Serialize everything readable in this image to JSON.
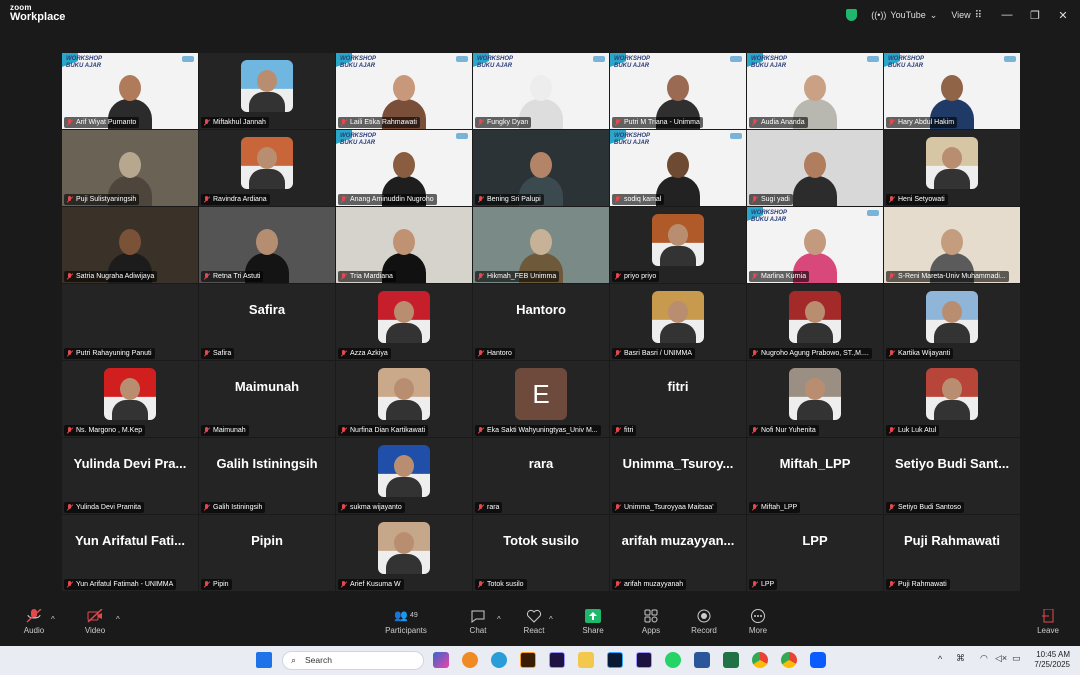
{
  "app": {
    "logo_line1": "zoom",
    "logo_line2": "Workplace"
  },
  "titlebar": {
    "stream_label": "YouTube",
    "view_label": "View"
  },
  "tiles": [
    {
      "name": "Arif Wiyat Purnanto",
      "type": "video",
      "bg": "banner",
      "skin": "#b07b5a",
      "cloth": "#2b2b2b",
      "active": true
    },
    {
      "name": "Miftakhul Jannah",
      "type": "avatar",
      "avatar_color": "#6fb6e0"
    },
    {
      "name": "Laili Etika Rahmawati",
      "type": "video",
      "bg": "banner",
      "skin": "#c7987a",
      "cloth": "#7a4f3a"
    },
    {
      "name": "Fungky Dyan",
      "type": "video",
      "bg": "banner",
      "skin": "#ededed",
      "cloth": "#dddddd"
    },
    {
      "name": "Putri M Triana - Unimma",
      "type": "video",
      "bg": "banner",
      "skin": "#9a6b52",
      "cloth": "#2f2f2f"
    },
    {
      "name": "Audia Ananda",
      "type": "video",
      "bg": "banner",
      "skin": "#caa184",
      "cloth": "#b8b8b0"
    },
    {
      "name": "Hary Abdul Hakim",
      "type": "video",
      "bg": "banner",
      "skin": "#8f6447",
      "cloth": "#1f3a66"
    },
    {
      "name": "Puji Sulistyaningsih",
      "type": "video",
      "bg": "#6b6256",
      "skin": "#b8a78f",
      "cloth": "#4e463c"
    },
    {
      "name": "Ravindra Ardiana",
      "type": "avatar",
      "avatar_color": "#c8663a"
    },
    {
      "name": "Anang Aminuddin Nugroho",
      "type": "video",
      "bg": "banner",
      "skin": "#8a5d40",
      "cloth": "#1e1e1e"
    },
    {
      "name": "Bening Sri Palupi",
      "type": "video",
      "bg": "#2b3336",
      "skin": "#b48468",
      "cloth": "#3a4a4e"
    },
    {
      "name": "sodiq kamal",
      "type": "video",
      "bg": "slide",
      "skin": "#6f4a33",
      "cloth": "#222"
    },
    {
      "name": "Sugi yadi",
      "type": "video",
      "bg": "#d8d8d8",
      "skin": "#b07d5e",
      "cloth": "#2c2c2c"
    },
    {
      "name": "Heni Setyowati",
      "type": "avatar",
      "avatar_color": "#d7c6a4"
    },
    {
      "name": "Satria Nugraha Adiwijaya",
      "type": "video",
      "bg": "#3a3228",
      "skin": "#7a5238",
      "cloth": "#1c1c1c"
    },
    {
      "name": "Retna Tri Astuti",
      "type": "video",
      "bg": "#545454",
      "skin": "#b58e72",
      "cloth": "#141414"
    },
    {
      "name": "Tria Mardiana",
      "type": "video",
      "bg": "#d6d2cc",
      "skin": "#c09274",
      "cloth": "#111"
    },
    {
      "name": "Hikmah_FEB Unimma",
      "type": "video",
      "bg": "#7a8a86",
      "skin": "#c7b197",
      "cloth": "#6e5a3a"
    },
    {
      "name": "priyo priyo",
      "type": "avatar",
      "avatar_color": "#b05a2a"
    },
    {
      "name": "Marlina Kurnia",
      "type": "video",
      "bg": "banner",
      "skin": "#c49a7e",
      "cloth": "#d9487b"
    },
    {
      "name": "S-Reni Mareta-Univ Muhammadi...",
      "type": "video",
      "bg": "#e5dccd",
      "skin": "#c49d7f",
      "cloth": "#5b5b5b"
    },
    {
      "name": "Putri Rahayuning Panuti",
      "type": "blank"
    },
    {
      "name": "Safira",
      "type": "text",
      "big": "Safira"
    },
    {
      "name": "Azza Azkiya",
      "type": "avatar",
      "avatar_color": "#c61f2b"
    },
    {
      "name": "Hantoro",
      "type": "text",
      "big": "Hantoro"
    },
    {
      "name": "Basri Basri / UNIMMA",
      "type": "avatar",
      "avatar_color": "#c79a4e"
    },
    {
      "name": "Nugroho Agung Prabowo, ST.,M....",
      "type": "avatar",
      "avatar_color": "#a42a2a"
    },
    {
      "name": "Kartika Wijayanti",
      "type": "avatar",
      "avatar_color": "#8fb5d8"
    },
    {
      "name": "Ns. Margono , M.Kep",
      "type": "avatar",
      "avatar_color": "#d11f1f"
    },
    {
      "name": "Maimunah",
      "type": "text",
      "big": "Maimunah"
    },
    {
      "name": "Nurfina Dian Kartikawati",
      "type": "avatar",
      "avatar_color": "#c9a98a"
    },
    {
      "name": "Eka Sakti Wahyuningtyas_Univ M...",
      "type": "letter",
      "letter": "E"
    },
    {
      "name": "fitri",
      "type": "text",
      "big": "fitri"
    },
    {
      "name": "Nofi Nur Yuhenita",
      "type": "avatar",
      "avatar_color": "#9b8f84"
    },
    {
      "name": "Luk Luk Atul",
      "type": "avatar",
      "avatar_color": "#b8453a"
    },
    {
      "name": "Yulinda Devi Pramita",
      "type": "text",
      "big": "Yulinda Devi Pra..."
    },
    {
      "name": "Galih Istiningsih",
      "type": "text",
      "big": "Galih Istiningsih"
    },
    {
      "name": "sukma wijayanto",
      "type": "avatar",
      "avatar_color": "#1f4fa8"
    },
    {
      "name": "rara",
      "type": "text",
      "big": "rara"
    },
    {
      "name": "Unimma_Tsuroyyaa Maitsaa'",
      "type": "text",
      "big": "Unimma_Tsuroy..."
    },
    {
      "name": "Miftah_LPP",
      "type": "text",
      "big": "Miftah_LPP"
    },
    {
      "name": "Setiyo Budi Santoso",
      "type": "text",
      "big": "Setiyo Budi Sant..."
    },
    {
      "name": "Yun Arifatul Fatimah - UNIMMA",
      "type": "text",
      "big": "Yun Arifatul Fati..."
    },
    {
      "name": "Pipin",
      "type": "text",
      "big": "Pipin"
    },
    {
      "name": "Arief Kusuma W",
      "type": "avatar",
      "avatar_color": "#c7a78a"
    },
    {
      "name": "Totok susilo",
      "type": "text",
      "big": "Totok susilo"
    },
    {
      "name": "arifah muzayyanah",
      "type": "text",
      "big": "arifah muzayyan..."
    },
    {
      "name": "LPP",
      "type": "text",
      "big": "LPP"
    },
    {
      "name": "Puji Rahmawati",
      "type": "text",
      "big": "Puji Rahmawati"
    }
  ],
  "banner_text": "WORKSHOP\nBUKU AJAR",
  "toolbar": {
    "audio": "Audio",
    "video": "Video",
    "participants": "Participants",
    "participants_count": "49",
    "chat": "Chat",
    "react": "React",
    "share": "Share",
    "apps": "Apps",
    "record": "Record",
    "more": "More",
    "leave": "Leave"
  },
  "taskbar": {
    "search_placeholder": "Search",
    "time": "10:45 AM",
    "date": "7/25/2025"
  },
  "colors": {
    "active_speaker": "#22c55e",
    "muted_mic": "#e5484d",
    "share_green": "#1fb76b"
  }
}
